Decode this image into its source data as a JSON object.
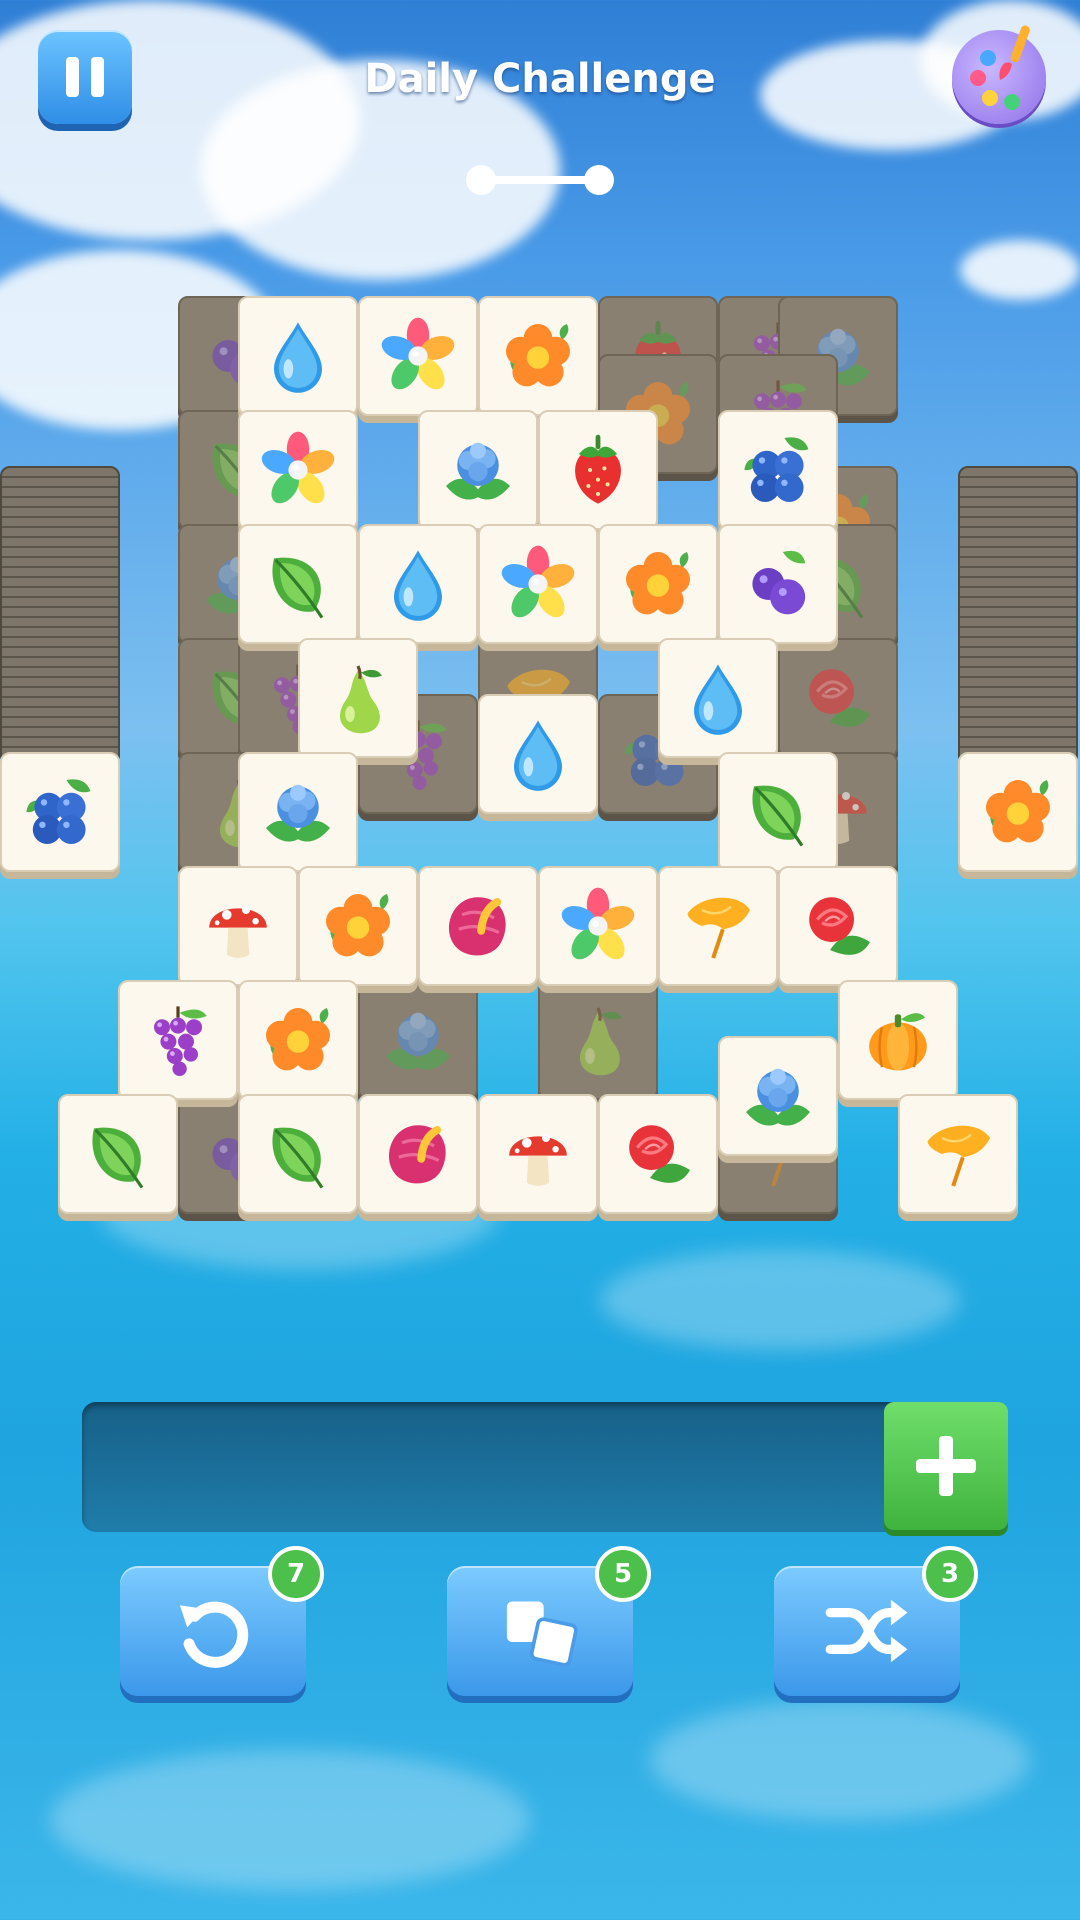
{
  "header": {
    "title": "Daily Challenge",
    "progress": 0.0
  },
  "tray": {
    "slots_filled": 0
  },
  "tools": [
    {
      "name": "undo",
      "icon": "undo-icon",
      "count": "7"
    },
    {
      "name": "return",
      "icon": "cards-return-icon",
      "count": "5"
    },
    {
      "name": "shuffle",
      "icon": "shuffle-icon",
      "count": "3"
    }
  ],
  "tile_icons": [
    "water-drop",
    "rainbow-flower",
    "orange-flower",
    "blue-rose",
    "strawberry",
    "blueberry",
    "leaf",
    "grape-plum",
    "pear",
    "mushroom",
    "pink-anthurium",
    "ginkgo-leaf",
    "red-rose",
    "grapes",
    "pumpkin"
  ],
  "colors": {
    "accent_blue": "#3c98ea",
    "accent_green": "#4dbf4b",
    "tile_face": "#fdf8ee"
  }
}
